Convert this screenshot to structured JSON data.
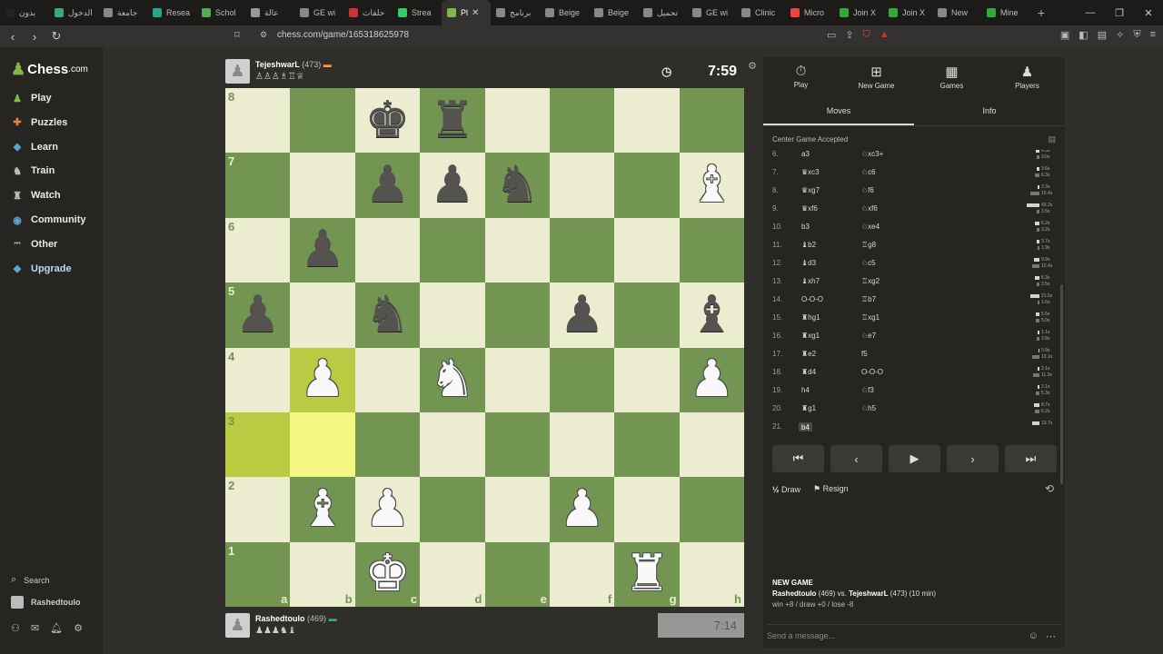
{
  "browser": {
    "tabs": [
      {
        "label": "بدون",
        "color": "#222"
      },
      {
        "label": "الدخول",
        "color": "#3a7"
      },
      {
        "label": "جامعة",
        "color": "#888"
      },
      {
        "label": "Resea",
        "color": "#2a8"
      },
      {
        "label": "Schol",
        "color": "#5a5"
      },
      {
        "label": "عالة",
        "color": "#999"
      },
      {
        "label": "GE wi",
        "color": "#888"
      },
      {
        "label": "حلقات",
        "color": "#c33"
      },
      {
        "label": "Strea",
        "color": "#3c6"
      },
      {
        "label": "Pl",
        "color": "#81b64c",
        "active": true
      },
      {
        "label": "برنامج",
        "color": "#888"
      },
      {
        "label": "Beige",
        "color": "#888"
      },
      {
        "label": "Beige",
        "color": "#888"
      },
      {
        "label": "تحميل",
        "color": "#888"
      },
      {
        "label": "GE wi",
        "color": "#888"
      },
      {
        "label": "Clinic",
        "color": "#888"
      },
      {
        "label": "Micro",
        "color": "#e44"
      },
      {
        "label": "Join X",
        "color": "#3a3"
      },
      {
        "label": "Join X",
        "color": "#3a3"
      },
      {
        "label": "New",
        "color": "#888"
      },
      {
        "label": "Mine",
        "color": "#3a3"
      }
    ],
    "url": "chess.com/game/165318625978"
  },
  "sidebar": {
    "logo": "Chess",
    "logo_suffix": ".com",
    "items": [
      {
        "label": "Play",
        "icon": "play-icon",
        "color": "#81b64c"
      },
      {
        "label": "Puzzles",
        "icon": "puzzle-icon",
        "color": "#e8823a"
      },
      {
        "label": "Learn",
        "icon": "learn-icon",
        "color": "#5aa7d6"
      },
      {
        "label": "Train",
        "icon": "train-icon",
        "color": "#bbb"
      },
      {
        "label": "Watch",
        "icon": "watch-icon",
        "color": "#bbb"
      },
      {
        "label": "Community",
        "icon": "community-icon",
        "color": "#5aa7d6"
      },
      {
        "label": "Other",
        "icon": "more-icon",
        "color": "#bbb"
      },
      {
        "label": "Upgrade",
        "icon": "diamond-icon",
        "color": "#5aa7d6"
      }
    ],
    "search_label": "Search",
    "username": "Rashedtoulo"
  },
  "top_player": {
    "name": "TejeshwarL",
    "rating": "(473)",
    "clock": "7:59"
  },
  "bottom_player": {
    "name": "Rashedtoulo",
    "rating": "(469)",
    "clock": "7:14"
  },
  "board": {
    "ranks": [
      "8",
      "7",
      "6",
      "5",
      "4",
      "3",
      "2",
      "1"
    ],
    "files": [
      "a",
      "b",
      "c",
      "d",
      "e",
      "f",
      "g",
      "h"
    ],
    "pieces": {
      "c8": "bk",
      "d8": "br",
      "c7": "bp",
      "d7": "bp",
      "e7": "bn",
      "h7": "wb",
      "b6": "bp",
      "a5": "bp",
      "c5": "bn",
      "f5": "bp",
      "h5": "bb",
      "b4": "wp",
      "d4": "wn",
      "h4": "wp",
      "b2": "wb",
      "c2": "wp",
      "f2": "wp",
      "c1": "wk",
      "g1": "wr"
    },
    "highlights": [
      "b4",
      "a3",
      "b3"
    ]
  },
  "panel": {
    "tabs": [
      {
        "label": "Play",
        "icon": "stopwatch-icon"
      },
      {
        "label": "New Game",
        "icon": "plus-icon"
      },
      {
        "label": "Games",
        "icon": "board-icon"
      },
      {
        "label": "Players",
        "icon": "players-icon"
      }
    ],
    "subtabs": [
      "Moves",
      "Info"
    ],
    "opening": "Center Game Accepted",
    "moves": [
      {
        "n": "6.",
        "w": "a3",
        "b": "♘xc3+",
        "t1": "4.5s",
        "t2": "3.0s",
        "w1": 4,
        "w2": 3
      },
      {
        "n": "7.",
        "w": "♛xc3",
        "b": "♘c6",
        "t1": "3.6s",
        "t2": "6.3s",
        "w1": 3,
        "w2": 5
      },
      {
        "n": "8.",
        "w": "♛xg7",
        "b": "♘f6",
        "t1": "2.3s",
        "t2": "15.4s",
        "w1": 2,
        "w2": 10
      },
      {
        "n": "9.",
        "w": "♛xf6",
        "b": "♘xf6",
        "t1": "43.2s",
        "t2": "3.5s",
        "w1": 14,
        "w2": 3
      },
      {
        "n": "10.",
        "w": "b3",
        "b": "♘xe4",
        "t1": "6.2s",
        "t2": "3.2s",
        "w1": 5,
        "w2": 3
      },
      {
        "n": "11.",
        "w": "♝b2",
        "b": "♖g8",
        "t1": "3.7s",
        "t2": "1.9s",
        "w1": 3,
        "w2": 2
      },
      {
        "n": "12.",
        "w": "♝d3",
        "b": "♘c5",
        "t1": "9.9s",
        "t2": "12.4s",
        "w1": 6,
        "w2": 8
      },
      {
        "n": "13.",
        "w": "♝xh7",
        "b": "♖xg2",
        "t1": "6.3s",
        "t2": "3.5s",
        "w1": 5,
        "w2": 3
      },
      {
        "n": "14.",
        "w": "O-O-O",
        "b": "♖b7",
        "t1": "21.5s",
        "t2": "1.6s",
        "w1": 10,
        "w2": 2
      },
      {
        "n": "15.",
        "w": "♜hg1",
        "b": "♖xg1",
        "t1": "5.5s",
        "t2": "5.0s",
        "w1": 4,
        "w2": 4
      },
      {
        "n": "16.",
        "w": "♜xg1",
        "b": "♘e7",
        "t1": "1.1s",
        "t2": "3.8s",
        "w1": 2,
        "w2": 3
      },
      {
        "n": "17.",
        "w": "♜e2",
        "b": "f5",
        "t1": "0.9s",
        "t2": "13.1s",
        "w1": 1,
        "w2": 8
      },
      {
        "n": "18.",
        "w": "♜d4",
        "b": "O-O-O",
        "t1": "2.1s",
        "t2": "11.3s",
        "w1": 2,
        "w2": 7
      },
      {
        "n": "19.",
        "w": "h4",
        "b": "♘f3",
        "t1": "2.1s",
        "t2": "5.3s",
        "w1": 2,
        "w2": 4
      },
      {
        "n": "20.",
        "w": "♜g1",
        "b": "♘h5",
        "t1": "8.7s",
        "t2": "6.2s",
        "w1": 6,
        "w2": 5
      },
      {
        "n": "21.",
        "w": "b4",
        "b": "",
        "t1": "13.7s",
        "t2": "",
        "w1": 8,
        "w2": 0
      }
    ],
    "draw_label": "Draw",
    "resign_label": "Resign",
    "newgame": {
      "title": "NEW GAME",
      "p1": "Rashedtoulo",
      "p1_rating": "(469)",
      "vs": "vs.",
      "p2": "TejeshwarL",
      "p2_rating": "(473)",
      "mode": "(10 min)",
      "record": "win +8 / draw +0 / lose -8"
    },
    "message_placeholder": "Send a message..."
  }
}
